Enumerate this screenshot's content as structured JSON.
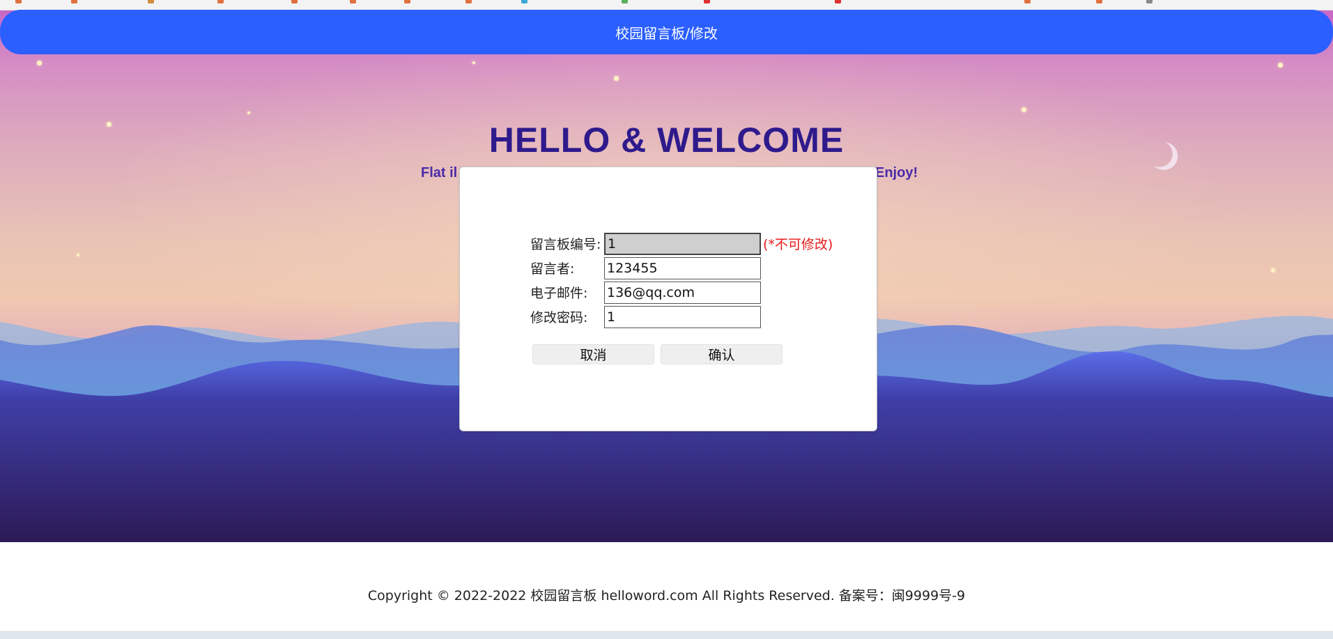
{
  "header": {
    "title": "校园留言板/修改"
  },
  "hero": {
    "title": "HELLO & WELCOME",
    "subtitle_left": "Flat il",
    "subtitle_right": "Enjoy!"
  },
  "form": {
    "id": {
      "label": "留言板编号:",
      "value": "1",
      "note": "(*不可修改)"
    },
    "author": {
      "label": "留言者:",
      "value": "123455"
    },
    "email": {
      "label": "电子邮件:",
      "value": "136@qq.com"
    },
    "password": {
      "label": "修改密码:",
      "value": "1"
    },
    "cancel_label": "取消",
    "confirm_label": "确认"
  },
  "footer": {
    "text": "Copyright © 2022-2022 校园留言板 helloword.com All Rights Reserved. 备案号：闽9999号-9"
  },
  "colors": {
    "header_bg": "#2b5fff",
    "title_color": "#2e1a8c",
    "note_color": "#e81919",
    "readonly_bg": "#cfcfcf"
  },
  "icons": {
    "moon": "crescent-moon-icon"
  }
}
